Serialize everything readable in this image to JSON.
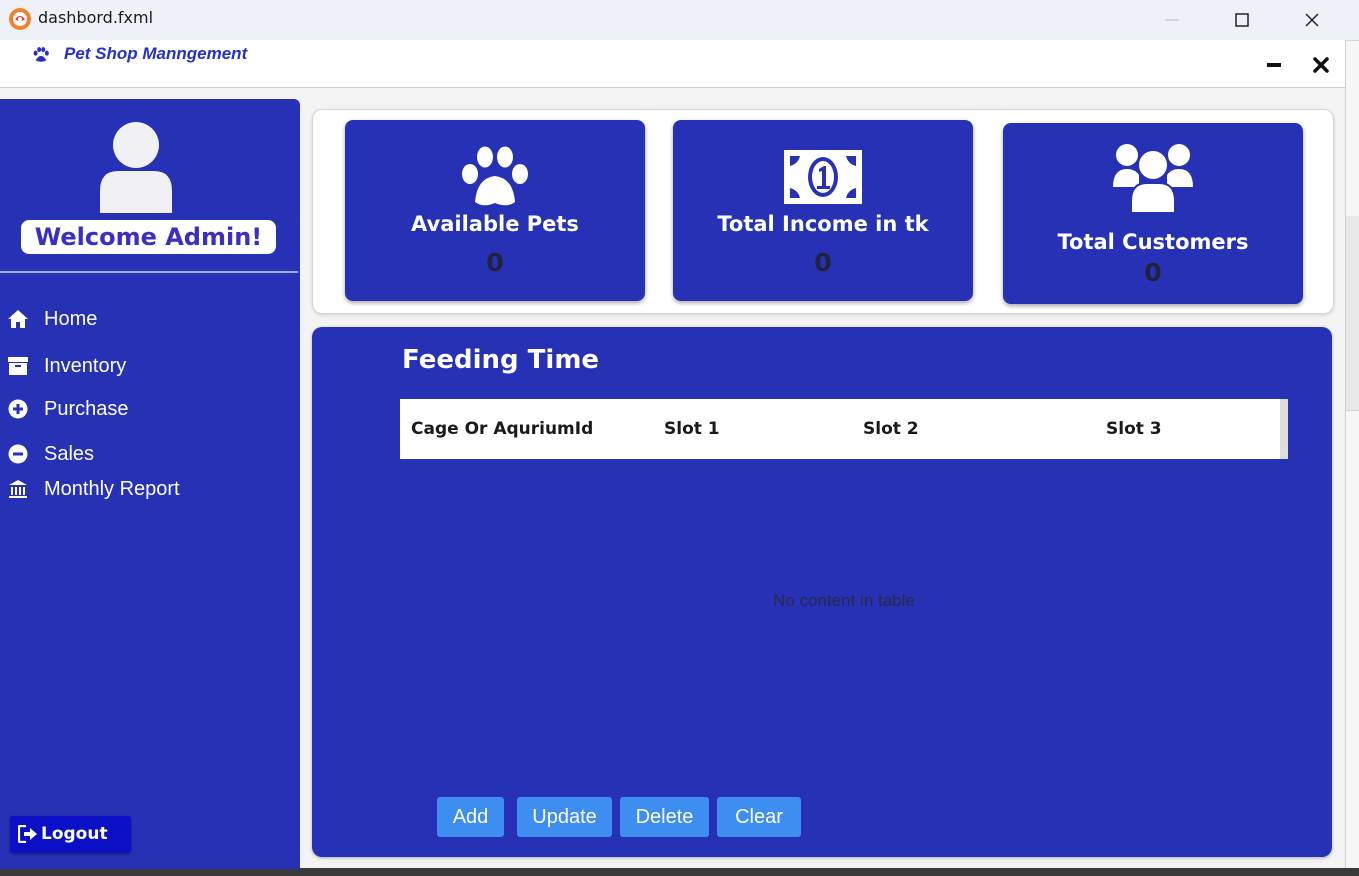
{
  "window": {
    "title": "dashbord.fxml",
    "app_icon": "app-logo-icon"
  },
  "header": {
    "title": "Pet Shop Manngement",
    "logo_icon": "paw-icon"
  },
  "sidebar": {
    "welcome": "Welcome Admin!",
    "items": [
      {
        "label": "Home",
        "icon": "home-icon"
      },
      {
        "label": "Inventory",
        "icon": "archive-box-icon"
      },
      {
        "label": "Purchase",
        "icon": "plus-circle-icon"
      },
      {
        "label": "Sales",
        "icon": "minus-circle-icon"
      },
      {
        "label": "Monthly Report",
        "icon": "bank-icon"
      }
    ],
    "logout_label": "Logout"
  },
  "stats": [
    {
      "label": "Available Pets",
      "value": "0",
      "icon": "paw-icon"
    },
    {
      "label": "Total Income in tk",
      "value": "0",
      "icon": "money-bill-icon"
    },
    {
      "label": "Total Customers",
      "value": "0",
      "icon": "users-icon"
    }
  ],
  "feeding": {
    "title": "Feeding Time",
    "columns": [
      "Cage Or AquriumId",
      "Slot 1",
      "Slot 2",
      "Slot 3"
    ],
    "empty_text": "No content in table",
    "buttons": [
      "Add",
      "Update",
      "Delete",
      "Clear"
    ]
  },
  "colors": {
    "primary": "#2731b5",
    "button": "#3d8ef0",
    "header_text": "#2430c8",
    "logout": "#0b10c6"
  }
}
